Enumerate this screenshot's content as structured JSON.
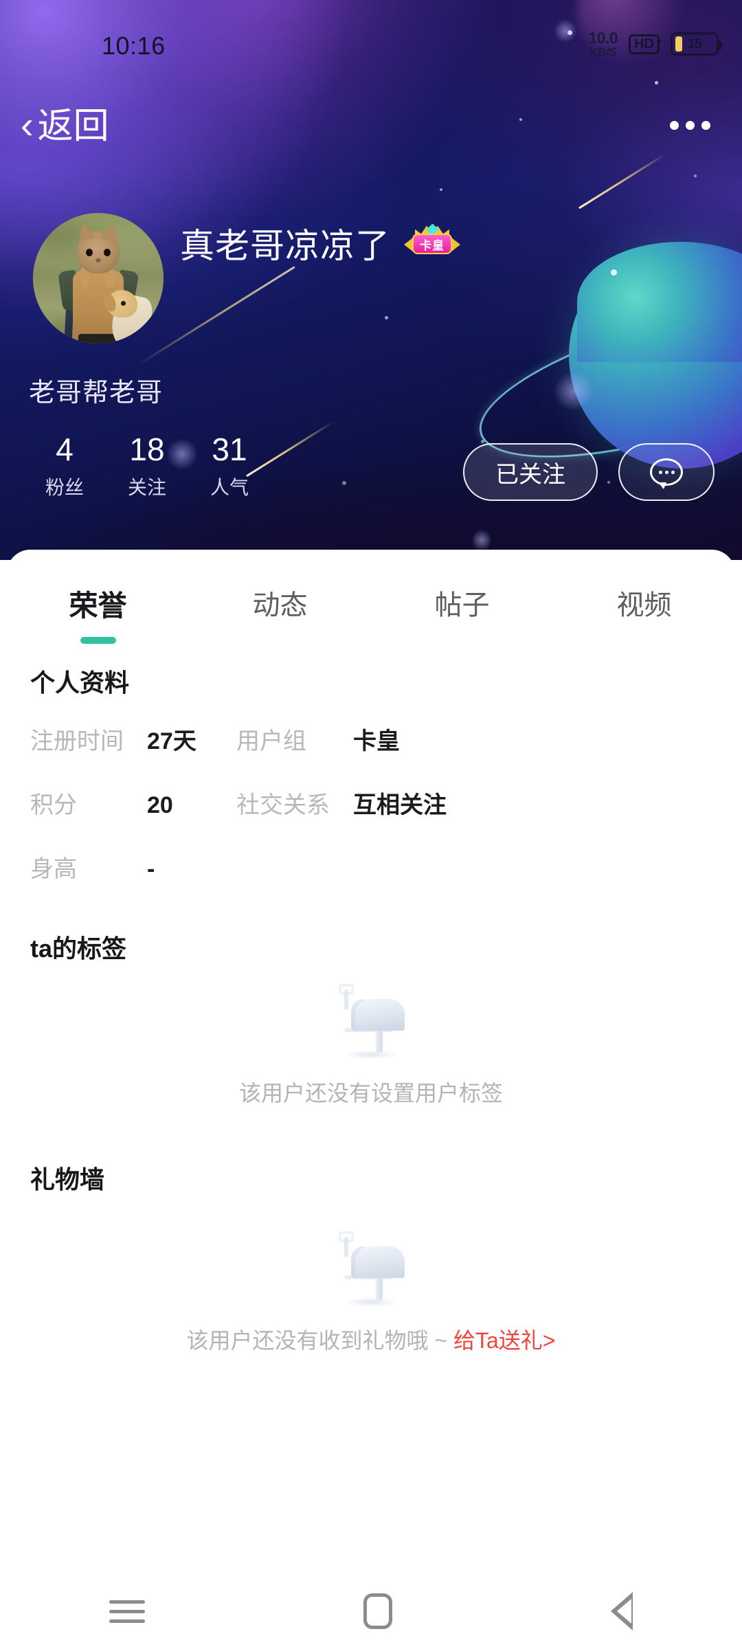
{
  "status_bar": {
    "clock": "10:16",
    "net_speed_value": "10.0",
    "net_speed_unit": "KB/S",
    "hd_badge": "HD",
    "battery_level": "15"
  },
  "nav": {
    "back_label": "返回",
    "more_label": "•••"
  },
  "profile": {
    "username": "真老哥凉凉了",
    "badge_label": "卡皇",
    "signature": "老哥帮老哥",
    "stats": [
      {
        "num": "4",
        "label": "粉丝"
      },
      {
        "num": "18",
        "label": "关注"
      },
      {
        "num": "31",
        "label": "人气"
      }
    ],
    "follow_button": "已关注",
    "message_button_icon": "chat-bubble-icon"
  },
  "tabs": [
    {
      "label": "荣誉",
      "active": true
    },
    {
      "label": "动态",
      "active": false
    },
    {
      "label": "帖子",
      "active": false
    },
    {
      "label": "视频",
      "active": false
    }
  ],
  "info_section": {
    "title": "个人资料",
    "rows": [
      [
        {
          "key": "注册时间",
          "value": "27天"
        },
        {
          "key": "用户组",
          "value": "卡皇"
        }
      ],
      [
        {
          "key": "积分",
          "value": "20"
        },
        {
          "key": "社交关系",
          "value": "互相关注"
        }
      ],
      [
        {
          "key": "身高",
          "value": "-"
        }
      ]
    ]
  },
  "tags_section": {
    "title": "ta的标签",
    "empty_text": "该用户还没有设置用户标签",
    "empty_icon": "mailbox-icon"
  },
  "gift_section": {
    "title": "礼物墙",
    "empty_text": "该用户还没有收到礼物哦 ~ ",
    "empty_link": "给Ta送礼>",
    "empty_icon": "mailbox-icon"
  },
  "android_nav": {
    "recents": "recents-icon",
    "home": "home-icon",
    "back": "back-icon"
  },
  "colors": {
    "accent_teal": "#2fc0a0",
    "gift_link_red": "#f0453c",
    "badge_pink": "#e61f9b",
    "badge_gold": "#f5c82f",
    "hero_purple": "#6c4ae0",
    "hero_navy": "#141a66"
  }
}
